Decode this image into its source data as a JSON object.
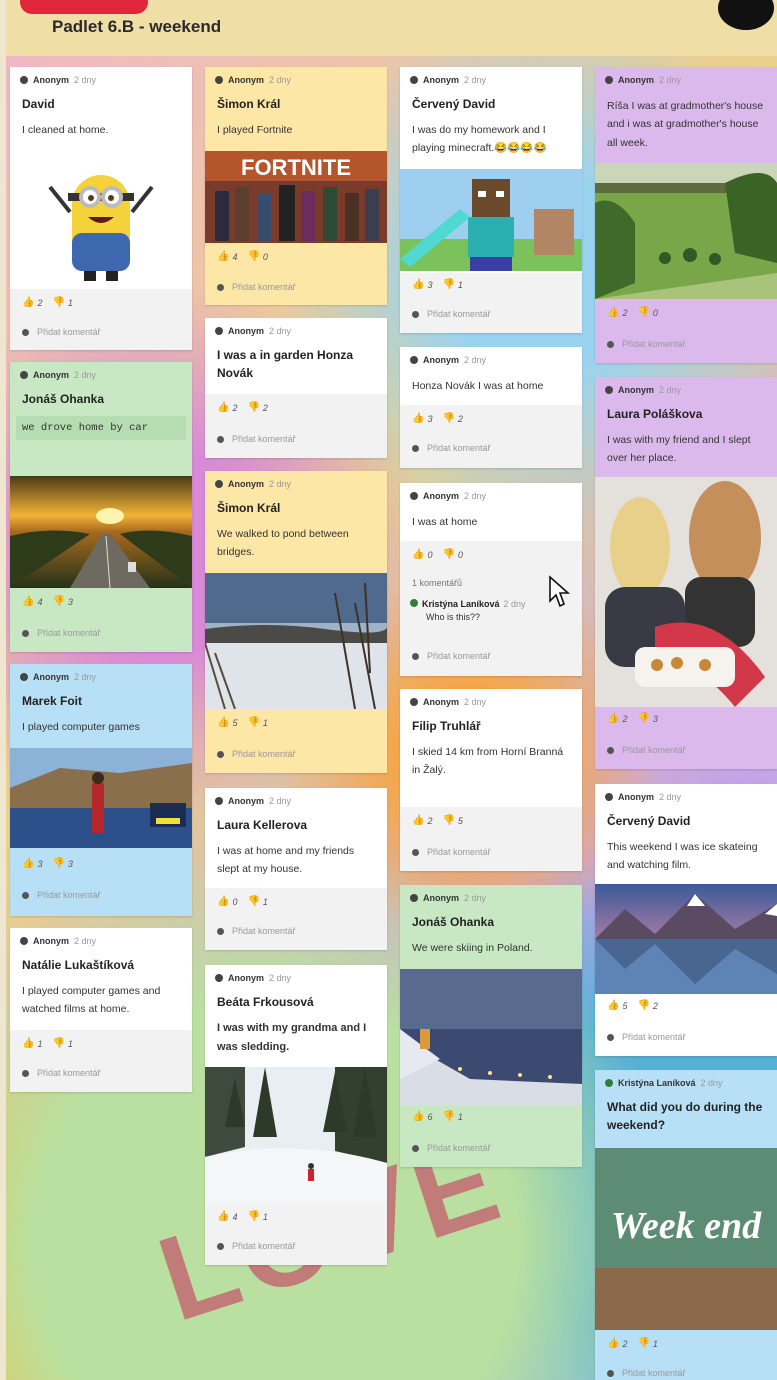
{
  "app": {
    "title": "Padlet 6.B - weekend"
  },
  "ui": {
    "thumb_up": "👍",
    "thumb_down": "👎",
    "comment_prompt": "Přidat komentář"
  },
  "cards": {
    "c1": {
      "author": "Anonym",
      "time": "2 dny",
      "title": "David",
      "body": "I cleaned at home.",
      "likes": "2",
      "dislikes": "1"
    },
    "c2": {
      "author": "Anonym",
      "time": "2 dny",
      "title": "Jonáš Ohanka",
      "body": "we drove home by car",
      "likes": "4",
      "dislikes": "3"
    },
    "c3": {
      "author": "Anonym",
      "time": "2 dny",
      "title": "Marek Foit",
      "body": "I played computer  games",
      "likes": "3",
      "dislikes": "3"
    },
    "c4": {
      "author": "Anonym",
      "time": "2 dny",
      "title": "Natálie Lukaštíková",
      "body": "I played computer games and watched films at home.",
      "likes": "1",
      "dislikes": "1"
    },
    "c5": {
      "author": "Anonym",
      "time": "2 dny",
      "title": "Šimon Král",
      "body": "I played Fortnite",
      "likes": "4",
      "dislikes": "0"
    },
    "c6": {
      "author": "Anonym",
      "time": "2 dny",
      "title": "I was a in garden Honza Novák",
      "likes": "2",
      "dislikes": "2"
    },
    "c7": {
      "author": "Anonym",
      "time": "2 dny",
      "title": "Šimon Král",
      "body": "We walked to pond between bridges.",
      "likes": "5",
      "dislikes": "1"
    },
    "c8": {
      "author": "Anonym",
      "time": "2 dny",
      "title": "Laura Kellerova",
      "body": "I was at home and my friends slept at my house.",
      "likes": "0",
      "dislikes": "1"
    },
    "c9": {
      "author": "Anonym",
      "time": "2 dny",
      "title": "Beáta Frkousová",
      "body": "I was with my grandma and I was sledding.",
      "likes": "4",
      "dislikes": "1"
    },
    "c10": {
      "author": "Anonym",
      "time": "2 dny",
      "title": "Červený David",
      "body": "I was do my homework and I playing minecraft.😂😂😂😂",
      "likes": "3",
      "dislikes": "1"
    },
    "c11": {
      "author": "Anonym",
      "time": "2 dny",
      "body": "Honza Novák I was at home",
      "likes": "3",
      "dislikes": "2"
    },
    "c12": {
      "author": "Anonym",
      "time": "2 dny",
      "body": "I was at home",
      "likes": "0",
      "dislikes": "0",
      "comment_count": "1 komentářů",
      "comment_author": "Kristýna Laníková",
      "comment_time": "2 dny",
      "comment_text": "Who is this??"
    },
    "c13": {
      "author": "Anonym",
      "time": "2 dny",
      "title": "Filip Truhlář",
      "body": "I skied 14 km from Horní Branná in Žalý.",
      "likes": "2",
      "dislikes": "5"
    },
    "c14": {
      "author": "Anonym",
      "time": "2 dny",
      "title": "Jonáš Ohanka",
      "body": "We were skiing in Poland.",
      "likes": "6",
      "dislikes": "1"
    },
    "c15": {
      "author": "Anonym",
      "time": "2 dny",
      "body": "Ríša I was at gradmother's house and i was at gradmother's house all week.",
      "likes": "2",
      "dislikes": "0"
    },
    "c16": {
      "author": "Anonym",
      "time": "2 dny",
      "title": "Laura Poláškova",
      "body": "I was with my friend and I slept over her place.",
      "likes": "2",
      "dislikes": "3"
    },
    "c17": {
      "author": "Anonym",
      "time": "2 dny",
      "title": "Červený David",
      "body": "This weekend I was ice skateing and watching film.",
      "likes": "5",
      "dislikes": "2"
    },
    "c18": {
      "author": "Kristýna Laníková",
      "time": "2 dny",
      "title": "What did you do during the weekend?",
      "likes": "2",
      "dislikes": "1"
    }
  },
  "images": {
    "fortnite_text": "FORTNITE",
    "weekend_text": "Week end"
  },
  "background": {
    "candy_text": "LOVE"
  }
}
